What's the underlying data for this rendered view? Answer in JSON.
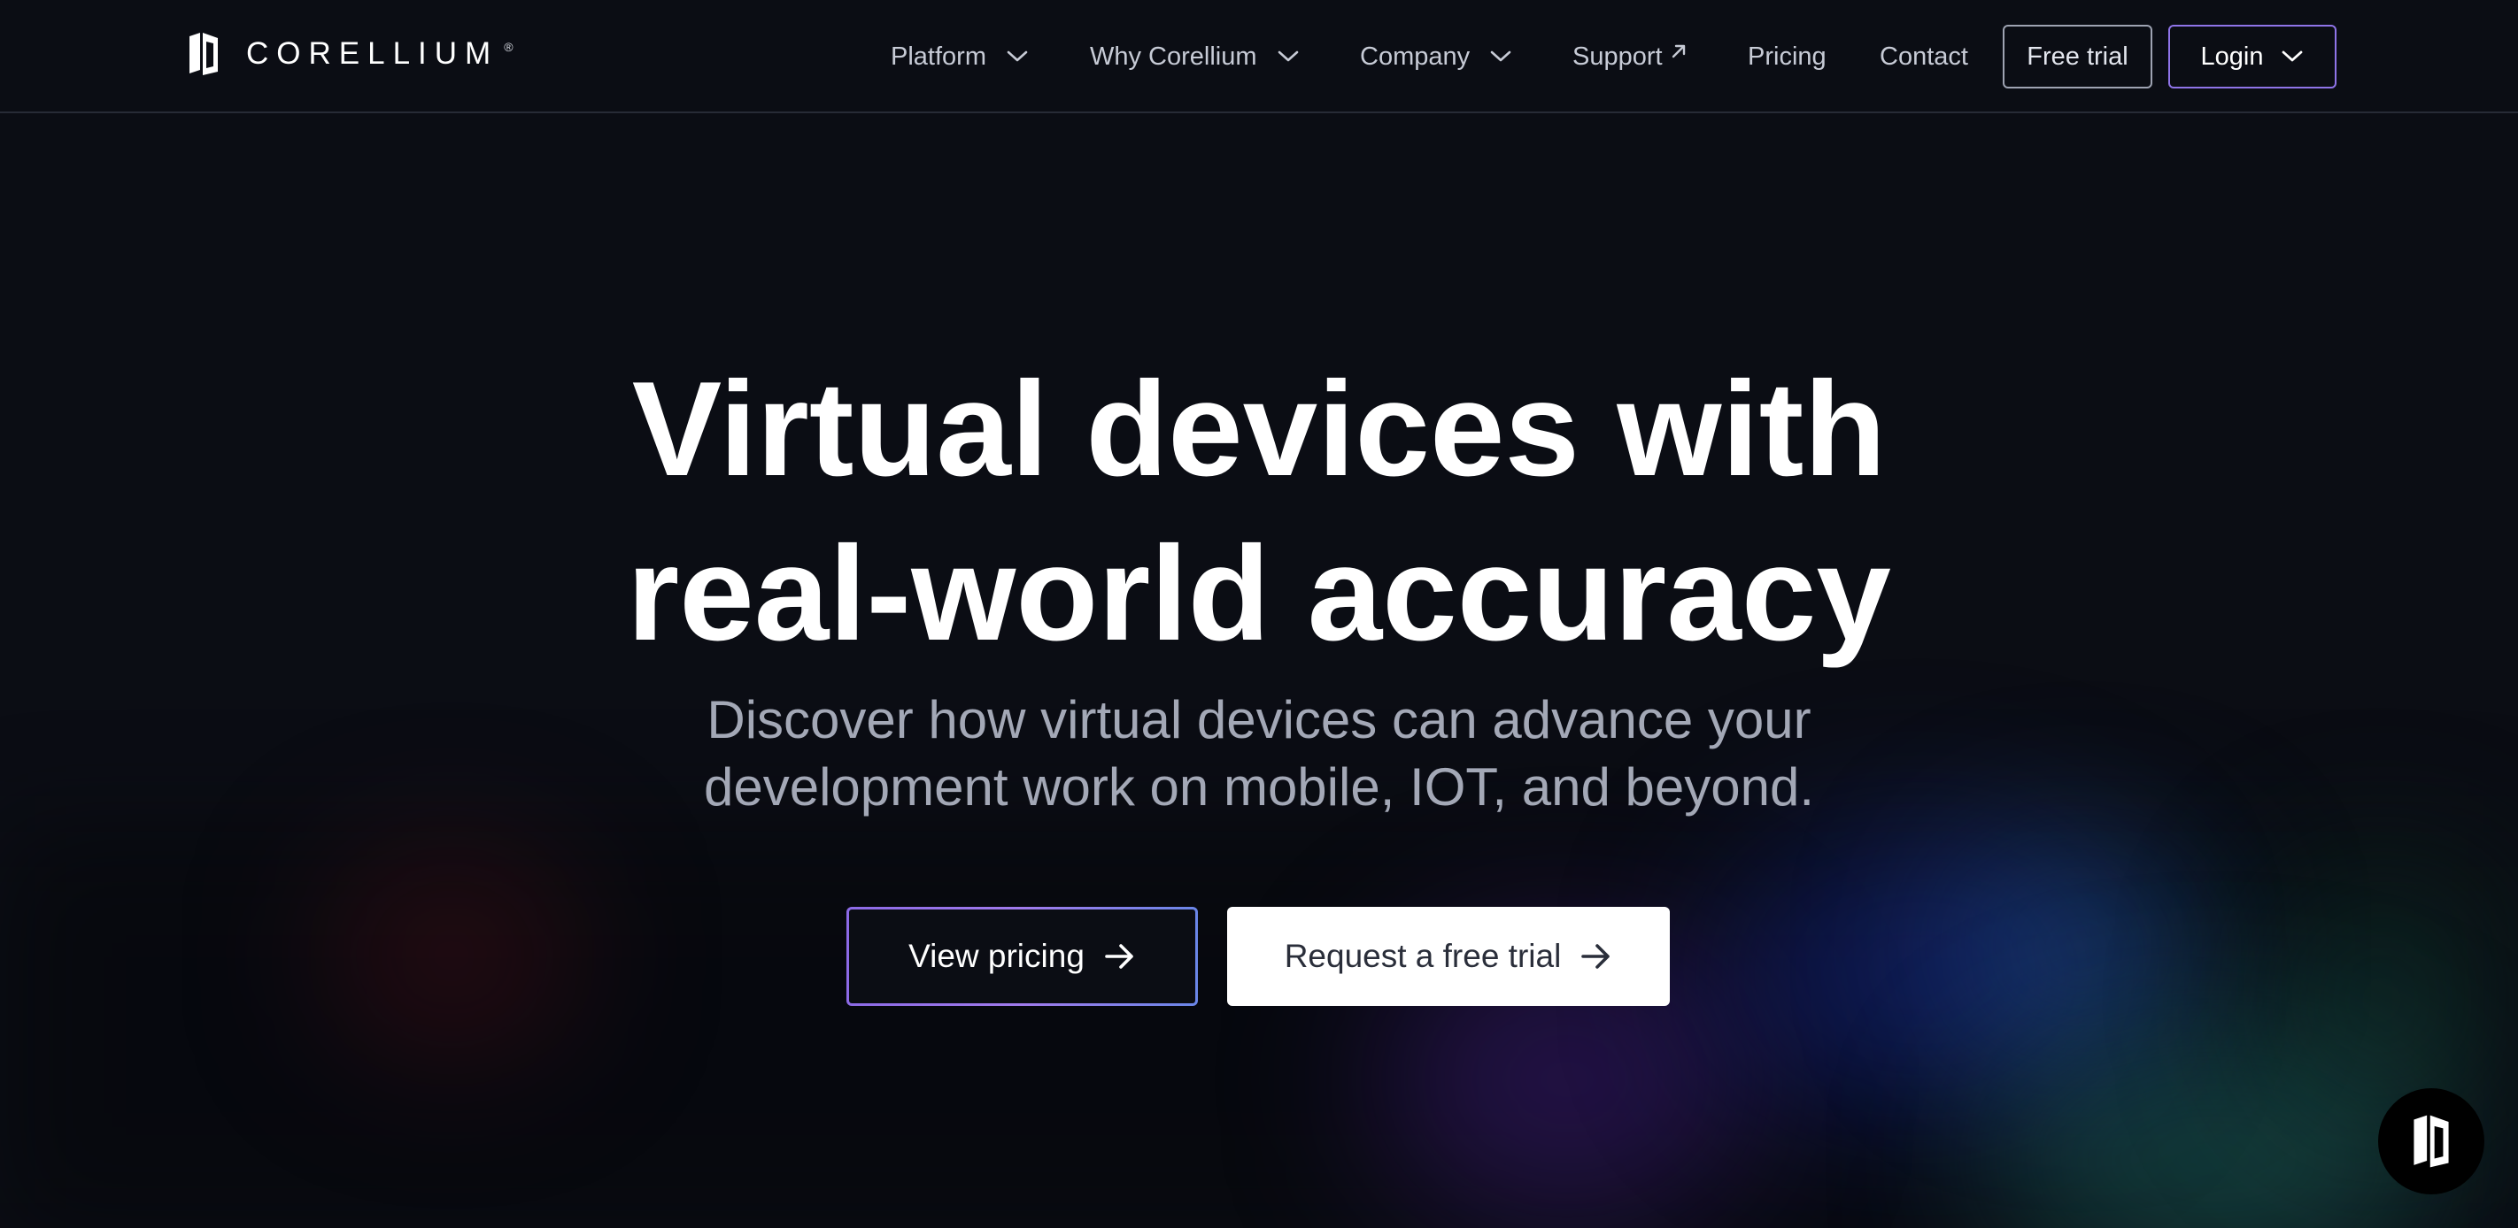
{
  "brand": {
    "name": "CORELLIUM",
    "registered_mark": "®"
  },
  "nav": {
    "items": [
      {
        "label": "Platform",
        "has_dropdown": true
      },
      {
        "label": "Why Corellium",
        "has_dropdown": true
      },
      {
        "label": "Company",
        "has_dropdown": true
      },
      {
        "label": "Support",
        "external": true
      },
      {
        "label": "Pricing"
      },
      {
        "label": "Contact"
      }
    ],
    "free_trial_label": "Free trial",
    "login_label": "Login"
  },
  "hero": {
    "title_line1": "Virtual devices with",
    "title_line2": "real-world accuracy",
    "subtitle_line1": "Discover how virtual devices can advance your",
    "subtitle_line2": "development work on mobile, IOT, and beyond.",
    "primary_cta": "View pricing",
    "secondary_cta": "Request a free trial"
  },
  "icons": {
    "logo": "corellium-logo-icon",
    "dropdown": "chevron-down-icon",
    "external": "external-link-icon",
    "cta_arrow": "arrow-right-icon",
    "chat": "chat-widget-icon"
  },
  "colors": {
    "background": "#0b0d14",
    "accent_border": "#8f74e8",
    "subtitle": "#a3a8b6",
    "nav_text": "#c7cbd6"
  }
}
